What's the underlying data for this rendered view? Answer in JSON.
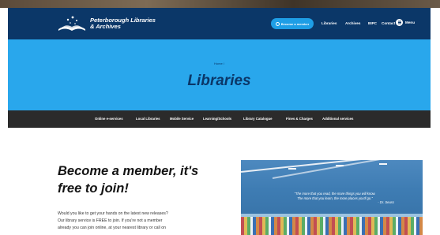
{
  "header": {
    "logo_line1": "Peterborough Libraries",
    "logo_line2": "& Archives",
    "logo_icon": "open-book-with-stars-logo",
    "cta_label": "Become a member",
    "cta_icon": "user-icon",
    "nav": [
      "Libraries",
      "Archives",
      "BIPC",
      "Contact"
    ],
    "menu_label": "Menu",
    "menu_icon": "hamburger-icon"
  },
  "hero": {
    "breadcrumb": "Home /",
    "title": "Libraries"
  },
  "subnav": {
    "items": [
      "Online e-services",
      "Local Libraries",
      "Mobile Service",
      "Learning/Schools",
      "Library Catalogue",
      "Fines & Charges",
      "Additional services"
    ]
  },
  "main": {
    "headline_line1": "Become a member, it's",
    "headline_line2": "free to join!",
    "body_line1": "Would you like to get your hands on the latest new releases?",
    "body_line2": "Our library service is FREE to join. If you're not a member",
    "body_line3": "already you can join online, at your nearest library or call on",
    "photo_quote_line1": "\"The more that you read, the more things you will know.",
    "photo_quote_line2": "The more that you learn, the more places you'll go.\"",
    "photo_quote_attr": "- Dr. Seuss"
  },
  "colors": {
    "header_bg": "#0b3768",
    "hero_bg": "#29a7ec",
    "cta_bg": "#1e9ee6",
    "subnav_bg": "#2b2b2b"
  }
}
